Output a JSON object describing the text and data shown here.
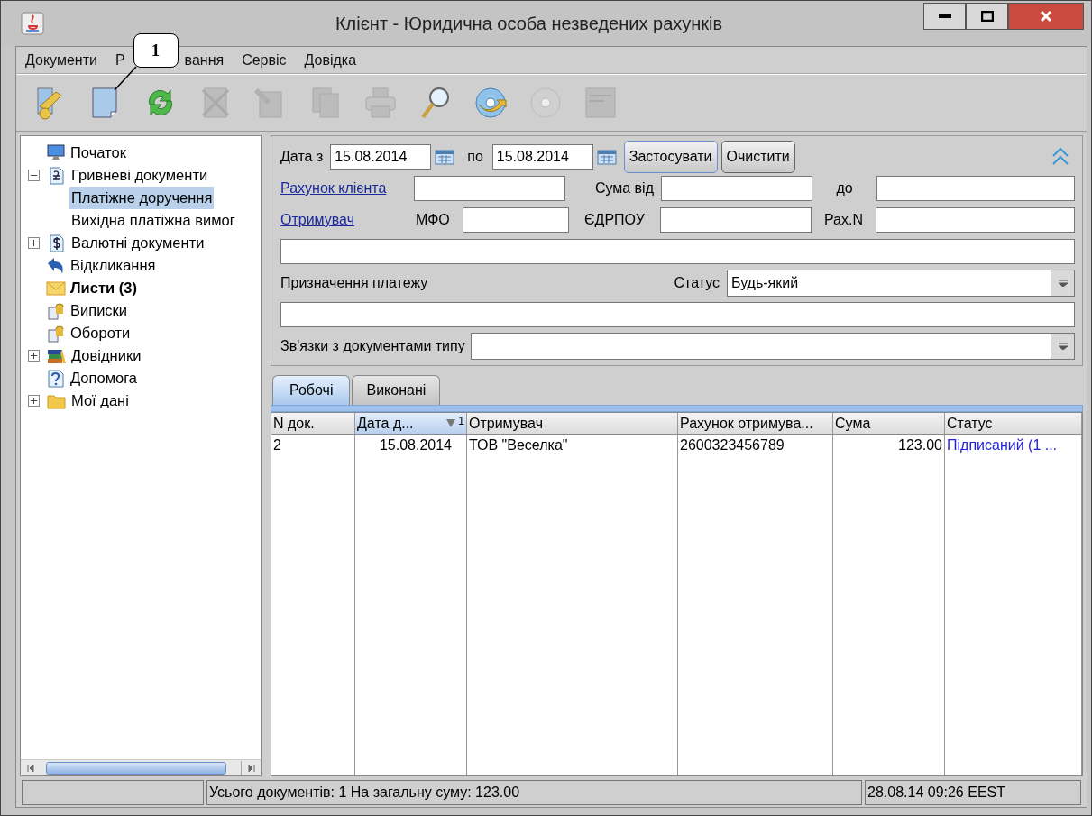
{
  "window": {
    "title": "Клієнт - Юридична особа незведених рахунків"
  },
  "callout": {
    "label": "1"
  },
  "menu": [
    {
      "label": "Документи"
    },
    {
      "label_parts": [
        "Р",
        "вання"
      ]
    },
    {
      "label": "Сервіс"
    },
    {
      "label": "Довідка"
    }
  ],
  "toolbar": [
    {
      "kind": "key",
      "disabled": false
    },
    {
      "kind": "document",
      "disabled": false
    },
    {
      "kind": "refresh",
      "disabled": false
    },
    {
      "kind": "delete",
      "disabled": true
    },
    {
      "kind": "sign",
      "disabled": true
    },
    {
      "kind": "copy",
      "disabled": true
    },
    {
      "kind": "print",
      "disabled": true
    },
    {
      "kind": "search",
      "disabled": false
    },
    {
      "kind": "disc",
      "disabled": false
    },
    {
      "kind": "disc",
      "disabled": true
    },
    {
      "kind": "form",
      "disabled": true
    }
  ],
  "tree": [
    {
      "label": "Початок",
      "kind": "monitor"
    },
    {
      "label": "Гривневі документи",
      "kind": "hryvnia",
      "expanded": true,
      "children": [
        {
          "label": "Платіжне доручення",
          "selected": true
        },
        {
          "label": "Вихідна платіжна вимог",
          "selected": false
        }
      ]
    },
    {
      "label": "Валютні документи",
      "kind": "dollar",
      "expanded": false
    },
    {
      "label": "Відкликання",
      "kind": "undo"
    },
    {
      "label": "Листи (3)",
      "kind": "mail",
      "bold": true
    },
    {
      "label": "Виписки",
      "kind": "coins"
    },
    {
      "label": "Обороти",
      "kind": "coins"
    },
    {
      "label": "Довідники",
      "kind": "books",
      "expanded": false
    },
    {
      "label": "Допомога",
      "kind": "help"
    },
    {
      "label": "Мої дані",
      "kind": "folder",
      "expanded": false
    }
  ],
  "filters": {
    "date_from_label": "Дата з",
    "date_from": "15.08.2014",
    "date_to_label": "по",
    "date_to": "15.08.2014",
    "apply_button": "Застосувати",
    "clear_button": "Очистити",
    "account_link": "Рахунок клієнта",
    "sum_from_label": "Сума від",
    "sum_to_label": "до",
    "recipient_link": "Отримувач",
    "mfo_label": "МФО",
    "edrpou_label": "ЄДРПОУ",
    "account_n_label": "Рах.N",
    "purpose_label": "Призначення платежу",
    "status_label": "Статус",
    "status_value": "Будь-який",
    "relations_label": "Зв'язки з документами типу"
  },
  "tabs": [
    {
      "label": "Робочі",
      "selected": true
    },
    {
      "label": "Виконані",
      "selected": false
    }
  ],
  "table": {
    "columns": [
      {
        "label": "N док.",
        "kind": "text",
        "sorted": false
      },
      {
        "label": "Дата д...",
        "kind": "date",
        "sorted": true,
        "sort_order": "1"
      },
      {
        "label": "Отримувач",
        "kind": "text",
        "sorted": false
      },
      {
        "label": "Рахунок отримува...",
        "kind": "text",
        "sorted": false
      },
      {
        "label": "Сума",
        "kind": "money",
        "sorted": false
      },
      {
        "label": "Статус",
        "kind": "status",
        "sorted": false
      }
    ],
    "rows": [
      [
        "2",
        "15.08.2014",
        "ТОВ \"Веселка\"",
        "2600323456789",
        "123.00",
        "Підписаний (1 ..."
      ]
    ]
  },
  "status_bar": {
    "summary": "Усього документів: 1 На загальну суму: 123.00",
    "time": "28.08.14 09:26 EEST"
  }
}
